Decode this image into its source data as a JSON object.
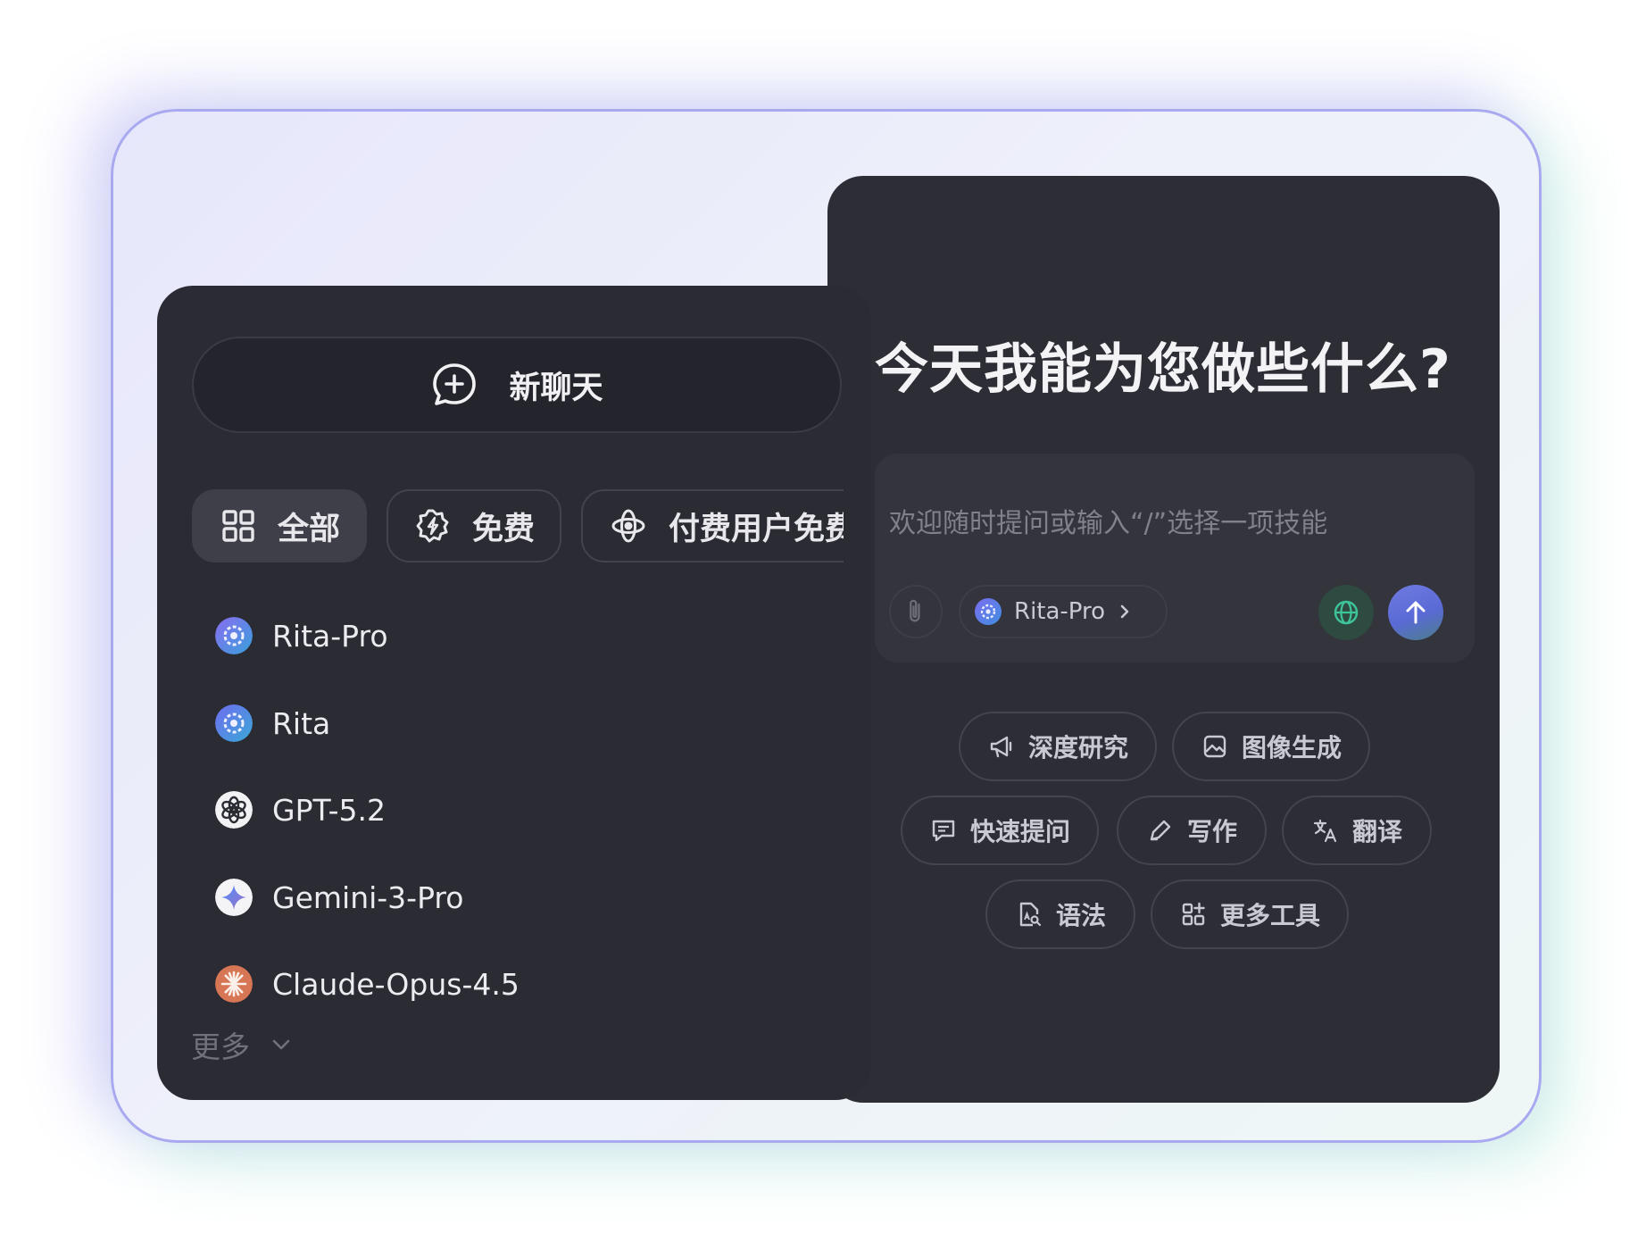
{
  "new_chat": {
    "label": "新聊天",
    "icon": "chat-plus-icon"
  },
  "filters": [
    {
      "label": "全部",
      "icon": "grid-icon",
      "active": true
    },
    {
      "label": "免费",
      "icon": "badge-icon",
      "active": false
    },
    {
      "label": "付费用户免费",
      "icon": "atom-icon",
      "active": false
    }
  ],
  "models": [
    {
      "name": "Rita-Pro",
      "icon": "rita-icon"
    },
    {
      "name": "Rita",
      "icon": "rita-icon"
    },
    {
      "name": "GPT-5.2",
      "icon": "openai-icon"
    },
    {
      "name": "Gemini-3-Pro",
      "icon": "gemini-icon"
    },
    {
      "name": "Claude-Opus-4.5",
      "icon": "claude-icon"
    }
  ],
  "more": {
    "label": "更多",
    "icon": "chevron-down-icon"
  },
  "main": {
    "headline": "今天我能为您做些什么?",
    "input_placeholder": "欢迎随时提问或输入“/”选择一项技能",
    "selected_model": "Rita-Pro"
  },
  "tools": [
    {
      "label": "深度研究",
      "icon": "megaphone-icon"
    },
    {
      "label": "图像生成",
      "icon": "image-icon"
    },
    {
      "label": "快速提问",
      "icon": "message-icon"
    },
    {
      "label": "写作",
      "icon": "pen-icon"
    },
    {
      "label": "翻译",
      "icon": "translate-icon"
    },
    {
      "label": "语法",
      "icon": "doc-search-icon"
    },
    {
      "label": "更多工具",
      "icon": "apps-add-icon"
    }
  ],
  "colors": {
    "panel_bg": "#2a2b33",
    "accent_send": "#5a6ad6",
    "accent_globe": "#2f4a40"
  }
}
